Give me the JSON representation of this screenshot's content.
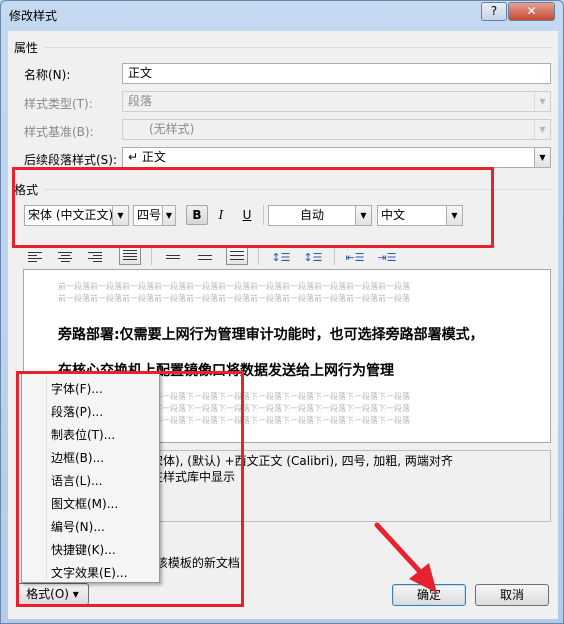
{
  "window": {
    "title": "修改样式",
    "help": "?",
    "close": "✕"
  },
  "properties": {
    "section_label": "属性",
    "name_label": "名称(N):",
    "name_value": "正文",
    "type_label": "样式类型(T):",
    "type_value": "段落",
    "based_label": "样式基准(B):",
    "based_value": "(无样式)",
    "next_label": "后续段落样式(S):",
    "next_value": "↵ 正文"
  },
  "formatting": {
    "section_label": "格式",
    "font": "宋体 (中文正文)",
    "size": "四号",
    "bold": "B",
    "italic": "I",
    "underline": "U",
    "color": "自动",
    "language": "中文"
  },
  "preview": {
    "prev_para": "前一段落前一段落前一段落前一段落前一段落前一段落前一段落前一段落前一段落前一段落前一段落",
    "sample_line1": "旁路部署:仅需要上网行为管理审计功能时，也可选择旁路部署模式，",
    "sample_line2": "在核心交换机上配置镜像口将数据发送给上网行为管理",
    "next_para": "下一段落下一段落下一段落下一段落下一段落下一段落下一段落下一段落下一段落下一段落下一段落"
  },
  "description": {
    "line1": "宋体), (默认) +西文正文 (Calibri), 四号, 加粗, 两端对齐",
    "line2": "在样式库中显示"
  },
  "options": {
    "template_text": "F该模板的新文档"
  },
  "format_menu": {
    "items": [
      "字体(F)...",
      "段落(P)...",
      "制表位(T)...",
      "边框(B)...",
      "语言(L)...",
      "图文框(M)...",
      "编号(N)...",
      "快捷键(K)...",
      "文字效果(E)..."
    ]
  },
  "buttons": {
    "format": "格式(O) ▾",
    "ok": "确定",
    "cancel": "取消"
  },
  "colors": {
    "highlight": "#e8212e",
    "dialog_bg": "#f0f0f0",
    "title_bg": "#c5d9f1"
  }
}
